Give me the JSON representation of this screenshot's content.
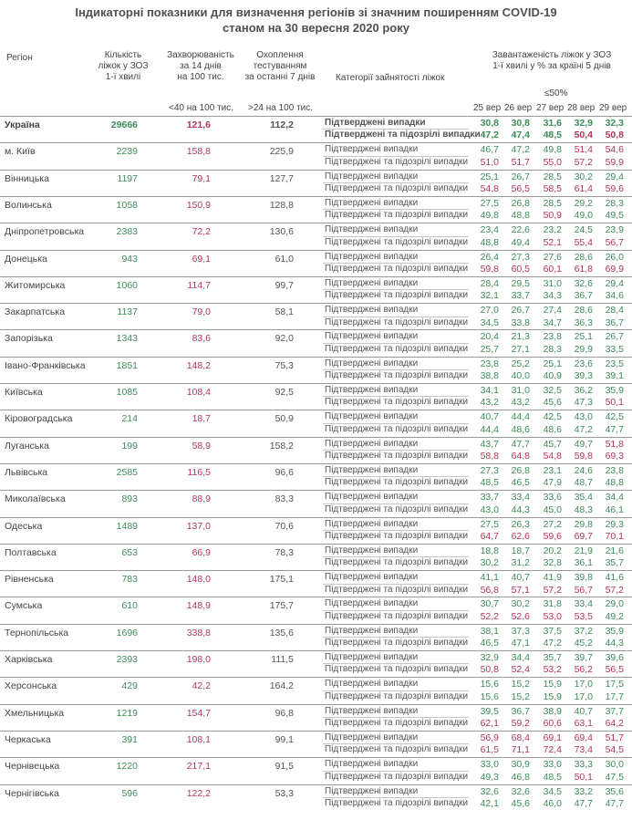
{
  "title": {
    "line1": "Індикаторні показники для визначення регіонів зі значним поширенням COVID-19",
    "line2": "станом на 30 вересня 2020 року"
  },
  "headers": {
    "region": "Регіон",
    "beds": [
      "Кількість",
      "ліжок у ЗОЗ",
      "1-ї хвилі"
    ],
    "incidence": [
      "Захворюваність",
      "за 14 днів",
      "на 100 тис."
    ],
    "testing": [
      "Охоплення",
      "тестуванням",
      "за останні 7 днів"
    ],
    "category": "Категорії зайнятості ліжок",
    "load": [
      "Завантаженість ліжок у ЗОЗ",
      "1-ї хвилі у % за країні 5 днів"
    ],
    "incidence_threshold": "<40 на 100 тис.",
    "testing_threshold": ">24 на 100 тис.",
    "load_threshold": "≤50%",
    "days": [
      "25 вер",
      "26 вер",
      "27 вер",
      "28 вер",
      "29 вер"
    ]
  },
  "categories": {
    "confirmed": "Підтверджені випадки",
    "suspected": "Підтверджені та підозрілі випадки"
  },
  "colors": {
    "green": "#3d8c5a",
    "red": "#b5365a"
  },
  "rows": [
    {
      "region": "Україна",
      "beds": "29666",
      "incidence": "121,6",
      "testing": "112,2",
      "bold": true,
      "c": [
        "30,8",
        "30,8",
        "31,6",
        "32,9",
        "32,3"
      ],
      "s": [
        "47,2",
        "47,4",
        "48,5",
        "50,4",
        "50,8"
      ]
    },
    {
      "region": "м. Київ",
      "beds": "2239",
      "incidence": "158,8",
      "testing": "225,9",
      "c": [
        "46,7",
        "47,2",
        "49,8",
        "51,4",
        "54,6"
      ],
      "s": [
        "51,0",
        "51,7",
        "55,0",
        "57,2",
        "59,9"
      ]
    },
    {
      "region": "Вінницька",
      "beds": "1197",
      "incidence": "79,1",
      "testing": "127,7",
      "c": [
        "25,1",
        "26,7",
        "28,5",
        "30,2",
        "29,4"
      ],
      "s": [
        "54,8",
        "56,5",
        "58,5",
        "61,4",
        "59,6"
      ]
    },
    {
      "region": "Волинська",
      "beds": "1058",
      "incidence": "150,9",
      "testing": "128,8",
      "c": [
        "27,5",
        "26,8",
        "28,5",
        "29,2",
        "28,3"
      ],
      "s": [
        "49,8",
        "48,8",
        "50,9",
        "49,0",
        "49,5"
      ]
    },
    {
      "region": "Дніпропетровська",
      "beds": "2383",
      "incidence": "72,2",
      "testing": "130,6",
      "c": [
        "23,4",
        "22,6",
        "23,2",
        "24,5",
        "23,9"
      ],
      "s": [
        "48,8",
        "49,4",
        "52,1",
        "55,4",
        "56,7"
      ]
    },
    {
      "region": "Донецька",
      "beds": "943",
      "incidence": "69,1",
      "testing": "61,0",
      "c": [
        "26,4",
        "27,3",
        "27,6",
        "28,6",
        "26,0"
      ],
      "s": [
        "59,8",
        "60,5",
        "60,1",
        "61,8",
        "69,9"
      ]
    },
    {
      "region": "Житомирська",
      "beds": "1060",
      "incidence": "114,7",
      "testing": "99,7",
      "c": [
        "28,4",
        "29,5",
        "31,0",
        "32,6",
        "29,4"
      ],
      "s": [
        "32,1",
        "33,7",
        "34,3",
        "36,7",
        "34,6"
      ]
    },
    {
      "region": "Закарпатська",
      "beds": "1137",
      "incidence": "79,0",
      "testing": "58,1",
      "c": [
        "27,0",
        "26,7",
        "27,4",
        "28,6",
        "28,4"
      ],
      "s": [
        "34,5",
        "33,8",
        "34,7",
        "36,3",
        "36,7"
      ]
    },
    {
      "region": "Запорізька",
      "beds": "1343",
      "incidence": "83,6",
      "testing": "92,0",
      "c": [
        "20,4",
        "21,3",
        "23,8",
        "25,1",
        "26,7"
      ],
      "s": [
        "25,7",
        "27,1",
        "28,3",
        "29,9",
        "33,5"
      ]
    },
    {
      "region": "Івано-Франківська",
      "beds": "1851",
      "incidence": "148,2",
      "testing": "75,3",
      "c": [
        "23,8",
        "25,2",
        "25,1",
        "23,6",
        "23,5"
      ],
      "s": [
        "38,8",
        "40,0",
        "40,9",
        "39,3",
        "39,1"
      ]
    },
    {
      "region": "Київська",
      "beds": "1085",
      "incidence": "108,4",
      "testing": "92,5",
      "c": [
        "34,1",
        "31,0",
        "32,5",
        "36,2",
        "35,9"
      ],
      "s": [
        "43,2",
        "43,2",
        "45,6",
        "47,3",
        "50,1"
      ]
    },
    {
      "region": "Кіровоградська",
      "beds": "214",
      "incidence": "18,7",
      "testing": "50,9",
      "c": [
        "40,7",
        "44,4",
        "42,5",
        "43,0",
        "42,5"
      ],
      "s": [
        "44,4",
        "48,6",
        "48,6",
        "47,2",
        "47,7"
      ]
    },
    {
      "region": "Луганська",
      "beds": "199",
      "incidence": "58,9",
      "testing": "158,2",
      "c": [
        "43,7",
        "47,7",
        "45,7",
        "49,7",
        "51,8"
      ],
      "s": [
        "58,8",
        "64,8",
        "54,8",
        "59,8",
        "69,3"
      ]
    },
    {
      "region": "Львівська",
      "beds": "2585",
      "incidence": "116,5",
      "testing": "96,6",
      "c": [
        "27,3",
        "26,8",
        "23,1",
        "24,6",
        "23,8"
      ],
      "s": [
        "48,5",
        "46,5",
        "47,9",
        "48,7",
        "48,8"
      ]
    },
    {
      "region": "Миколаївська",
      "beds": "893",
      "incidence": "88,9",
      "testing": "83,3",
      "c": [
        "33,7",
        "33,4",
        "33,6",
        "35,4",
        "34,4"
      ],
      "s": [
        "43,0",
        "44,3",
        "45,0",
        "48,3",
        "46,1"
      ]
    },
    {
      "region": "Одеська",
      "beds": "1489",
      "incidence": "137,0",
      "testing": "70,6",
      "c": [
        "27,5",
        "26,3",
        "27,2",
        "29,8",
        "29,3"
      ],
      "s": [
        "64,7",
        "62,6",
        "59,6",
        "69,7",
        "70,1"
      ]
    },
    {
      "region": "Полтавська",
      "beds": "653",
      "incidence": "66,9",
      "testing": "78,3",
      "c": [
        "18,8",
        "18,7",
        "20,2",
        "21,9",
        "21,6"
      ],
      "s": [
        "30,2",
        "31,2",
        "32,8",
        "36,1",
        "35,7"
      ]
    },
    {
      "region": "Рівненська",
      "beds": "783",
      "incidence": "148,0",
      "testing": "175,1",
      "c": [
        "41,1",
        "40,7",
        "41,9",
        "39,8",
        "41,6"
      ],
      "s": [
        "56,8",
        "57,1",
        "57,2",
        "56,7",
        "57,2"
      ]
    },
    {
      "region": "Сумська",
      "beds": "610",
      "incidence": "148,9",
      "testing": "175,7",
      "c": [
        "30,7",
        "30,2",
        "31,8",
        "33,4",
        "29,0"
      ],
      "s": [
        "52,2",
        "52,6",
        "53,0",
        "53,5",
        "49,2"
      ]
    },
    {
      "region": "Тернопільська",
      "beds": "1696",
      "incidence": "338,8",
      "testing": "135,6",
      "c": [
        "38,1",
        "37,3",
        "37,5",
        "37,2",
        "35,9"
      ],
      "s": [
        "46,5",
        "47,1",
        "47,2",
        "45,2",
        "44,3"
      ]
    },
    {
      "region": "Харківська",
      "beds": "2393",
      "incidence": "198,0",
      "testing": "111,5",
      "c": [
        "32,9",
        "34,4",
        "35,7",
        "39,7",
        "39,6"
      ],
      "s": [
        "50,8",
        "52,4",
        "53,2",
        "56,2",
        "56,5"
      ]
    },
    {
      "region": "Херсонська",
      "beds": "429",
      "incidence": "42,2",
      "testing": "164,2",
      "c": [
        "15,6",
        "15,2",
        "15,9",
        "17,0",
        "17,5"
      ],
      "s": [
        "15,6",
        "15,2",
        "15,9",
        "17,0",
        "17,7"
      ]
    },
    {
      "region": "Хмельницька",
      "beds": "1219",
      "incidence": "154,7",
      "testing": "96,8",
      "c": [
        "39,5",
        "36,7",
        "38,9",
        "40,7",
        "37,7"
      ],
      "s": [
        "62,1",
        "59,2",
        "60,6",
        "63,1",
        "64,2"
      ]
    },
    {
      "region": "Черкаська",
      "beds": "391",
      "incidence": "108,1",
      "testing": "99,1",
      "c": [
        "56,9",
        "68,4",
        "69,1",
        "69,4",
        "51,7"
      ],
      "s": [
        "61,5",
        "71,1",
        "72,4",
        "73,4",
        "54,5"
      ]
    },
    {
      "region": "Чернівецька",
      "beds": "1220",
      "incidence": "217,1",
      "testing": "91,5",
      "c": [
        "33,0",
        "30,9",
        "33,0",
        "33,3",
        "30,0"
      ],
      "s": [
        "49,3",
        "46,8",
        "48,5",
        "50,1",
        "47,5"
      ]
    },
    {
      "region": "Чернігівська",
      "beds": "596",
      "incidence": "122,2",
      "testing": "53,3",
      "c": [
        "32,6",
        "32,6",
        "34,5",
        "33,2",
        "35,6"
      ],
      "s": [
        "42,1",
        "45,6",
        "46,0",
        "47,7",
        "47,7"
      ]
    }
  ]
}
